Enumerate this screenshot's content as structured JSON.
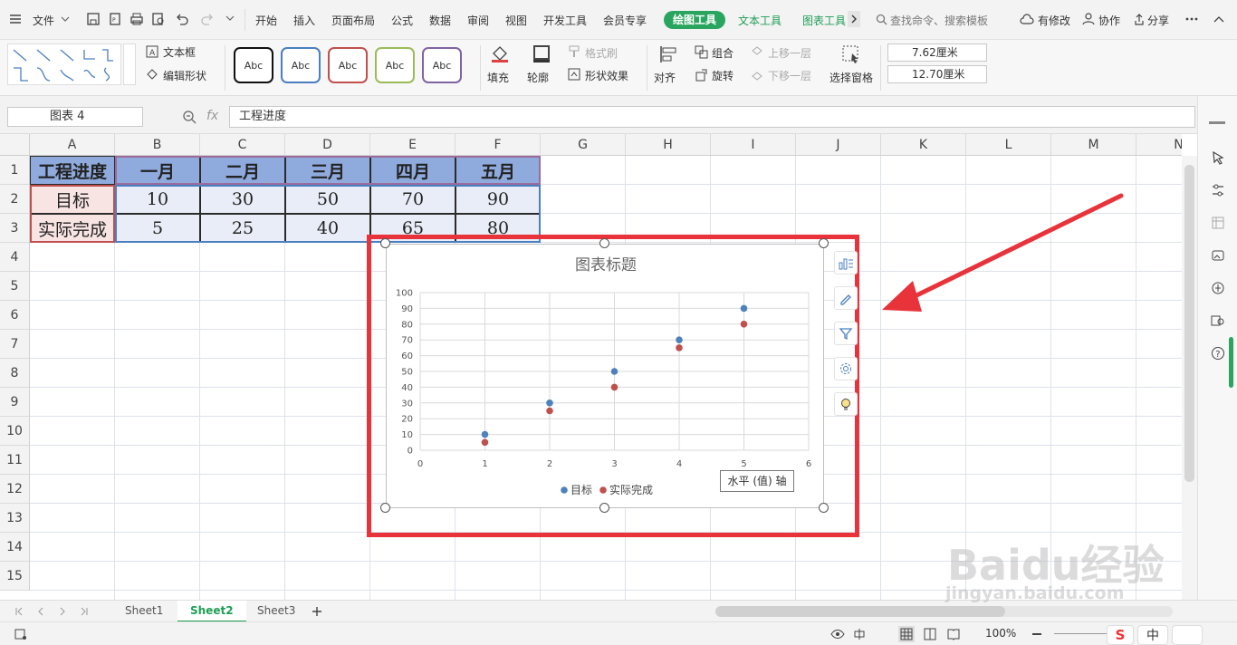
{
  "menubar": {
    "file": "文件",
    "items": [
      "开始",
      "插入",
      "页面布局",
      "公式",
      "数据",
      "审阅",
      "视图",
      "开发工具",
      "会员专享"
    ],
    "drawing_tool": "绘图工具",
    "text_tool": "文本工具",
    "chart_tool": "图表工具",
    "search": "查找命令、搜索模板",
    "modified": "有修改",
    "collab": "协作",
    "share": "分享"
  },
  "ribbon": {
    "textbox": "文本框",
    "edit_shape": "编辑形状",
    "style_labels": [
      "Abc",
      "Abc",
      "Abc",
      "Abc",
      "Abc"
    ],
    "style_colors": [
      "#111111",
      "#4a7fc1",
      "#c0504d",
      "#9bbb59",
      "#8064a2"
    ],
    "fill": "填充",
    "outline": "轮廓",
    "format_brush": "格式刷",
    "shape_effects": "形状效果",
    "align": "对齐",
    "group": "组合",
    "rotate": "旋转",
    "bring_forward": "上移一层",
    "send_backward": "下移一层",
    "selection_pane": "选择窗格",
    "height_value": "7.62厘米",
    "width_value": "12.70厘米"
  },
  "formula_bar": {
    "name_box": "图表 4",
    "fx": "fx",
    "content": "工程进度"
  },
  "sheet": {
    "columns": [
      "A",
      "B",
      "C",
      "D",
      "E",
      "F",
      "G",
      "H",
      "I",
      "J",
      "K",
      "L",
      "M",
      "N"
    ],
    "rows": [
      "1",
      "2",
      "3",
      "4",
      "5",
      "6",
      "7",
      "8",
      "9",
      "10",
      "11",
      "12",
      "13",
      "14",
      "15"
    ],
    "table": [
      [
        "工程进度",
        "一月",
        "二月",
        "三月",
        "四月",
        "五月"
      ],
      [
        "目标",
        "10",
        "30",
        "50",
        "70",
        "90"
      ],
      [
        "实际完成",
        "5",
        "25",
        "40",
        "65",
        "80"
      ]
    ]
  },
  "chart_data": {
    "type": "scatter",
    "title": "图表标题",
    "x": [
      1,
      2,
      3,
      4,
      5
    ],
    "series": [
      {
        "name": "目标",
        "values": [
          10,
          30,
          50,
          70,
          90
        ],
        "color": "#4f81bd"
      },
      {
        "name": "实际完成",
        "values": [
          5,
          25,
          40,
          65,
          80
        ],
        "color": "#c0504d"
      }
    ],
    "xlim": [
      0,
      6
    ],
    "ylim": [
      0,
      100
    ],
    "x_ticks": [
      "0",
      "1",
      "2",
      "3",
      "4",
      "5",
      "6"
    ],
    "y_ticks": [
      "0",
      "10",
      "20",
      "30",
      "40",
      "50",
      "60",
      "70",
      "80",
      "90",
      "100"
    ],
    "grid": true,
    "legend": "bottom",
    "tooltip": "水平 (值) 轴"
  },
  "sheet_tabs": [
    "Sheet1",
    "Sheet2",
    "Sheet3"
  ],
  "active_sheet": "Sheet2",
  "status": {
    "zoom": "100%",
    "ime_sogou": "S",
    "ime_lang": "中"
  },
  "watermark": {
    "brand": "Baidu经验",
    "url": "jingyan.baidu.com"
  },
  "colors": {
    "accent_green": "#2aa55f",
    "header_fill": "#8faadc",
    "label_fill": "#f9e4e4",
    "data_fill": "#e9edf7",
    "highlight_red": "#e8333a"
  }
}
